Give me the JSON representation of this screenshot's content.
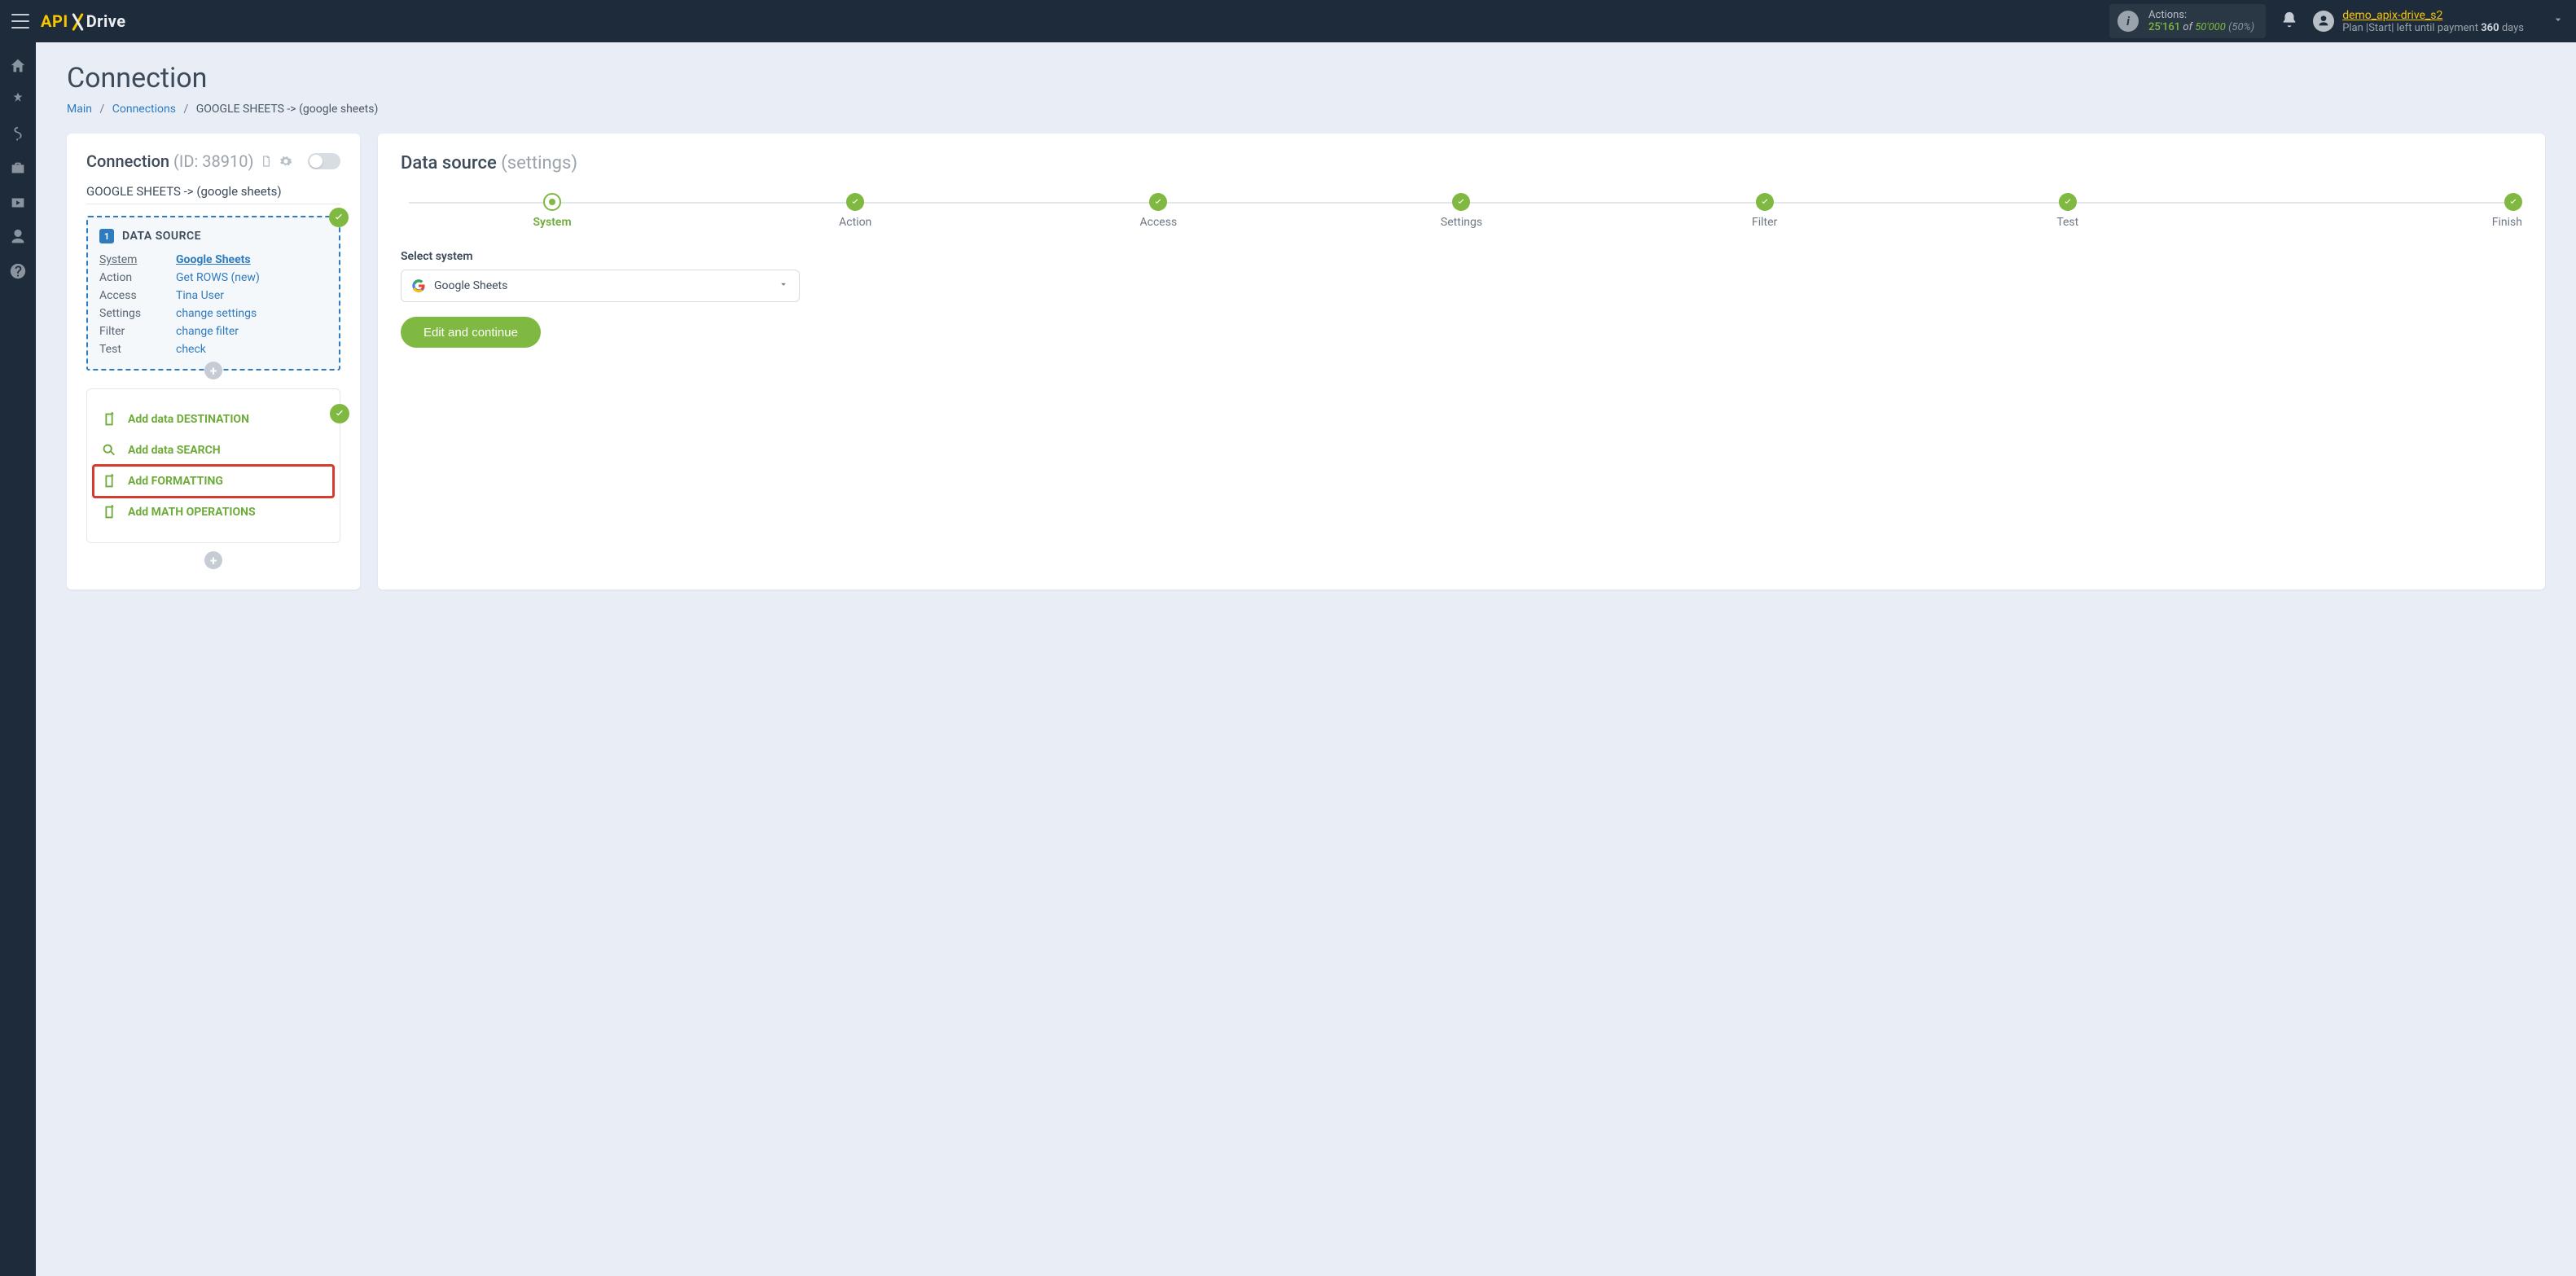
{
  "header": {
    "actions_label": "Actions:",
    "actions_used": "25'161",
    "actions_of": "of",
    "actions_total": "50'000",
    "actions_pct": "(50%)",
    "username": "demo_apix-drive_s2",
    "plan_prefix": "Plan |Start| left until payment ",
    "plan_days": "360",
    "plan_suffix": " days"
  },
  "page": {
    "title": "Connection",
    "crumb_main": "Main",
    "crumb_conns": "Connections",
    "crumb_current": "GOOGLE SHEETS -> (google sheets)"
  },
  "conn": {
    "heading": "Connection",
    "id_label": "(ID: 38910)",
    "subtitle": "GOOGLE SHEETS -> (google sheets)"
  },
  "ds": {
    "badge": "1",
    "title": "DATA SOURCE",
    "rows": {
      "system_label": "System",
      "system_value": "Google Sheets",
      "action_label": "Action",
      "action_value": "Get ROWS (new)",
      "access_label": "Access",
      "access_value": "Tina User",
      "settings_label": "Settings",
      "settings_value": "change settings",
      "filter_label": "Filter",
      "filter_value": "change filter",
      "test_label": "Test",
      "test_value": "check"
    }
  },
  "opts": {
    "add_destination": "Add data DESTINATION",
    "add_search": "Add data SEARCH",
    "add_formatting": "Add FORMATTING",
    "add_math": "Add MATH OPERATIONS"
  },
  "right": {
    "title": "Data source",
    "title_suffix": "(settings)",
    "steps": [
      "System",
      "Action",
      "Access",
      "Settings",
      "Filter",
      "Test",
      "Finish"
    ],
    "select_label": "Select system",
    "select_value": "Google Sheets",
    "button": "Edit and continue"
  }
}
